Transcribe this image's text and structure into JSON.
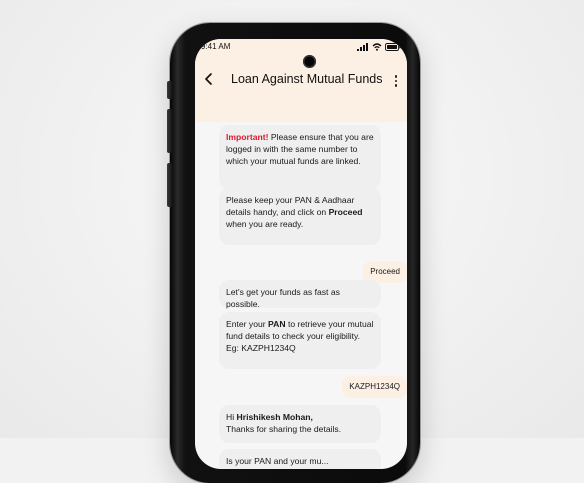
{
  "status_bar": {
    "time": "9:41 AM"
  },
  "app_bar": {
    "title": "Loan Against Mutual Funds"
  },
  "messages": {
    "important": {
      "highlight": "Important!",
      "text": " Please ensure that you are logged in with the same number to which your mutual funds are linked."
    },
    "keep_details": {
      "text_before": "Please keep your PAN & Aadhaar details handy, and click on ",
      "emphasis": "Proceed",
      "text_after": " when you are ready."
    },
    "user_proceed": "Proceed",
    "get_funds": "Let's get your funds as fast as possible.",
    "enter_pan": {
      "text_before": "Enter your ",
      "emphasis": "PAN",
      "text_after": " to retrieve your mutual fund details to check your eligibility.",
      "example": "Eg: KAZPH1234Q"
    },
    "user_pan": "KAZPH1234Q",
    "greeting": {
      "line1_prefix": "Hi ",
      "name": "Hrishikesh Mohan,",
      "line2": "Thanks for sharing the details."
    },
    "next_partial": "Is your PAN and your mu..."
  },
  "colors": {
    "accent_red": "#e0182d",
    "header_bg": "#fcefe4",
    "bubble_bot": "#efefef",
    "bubble_user": "#fcefe4"
  }
}
